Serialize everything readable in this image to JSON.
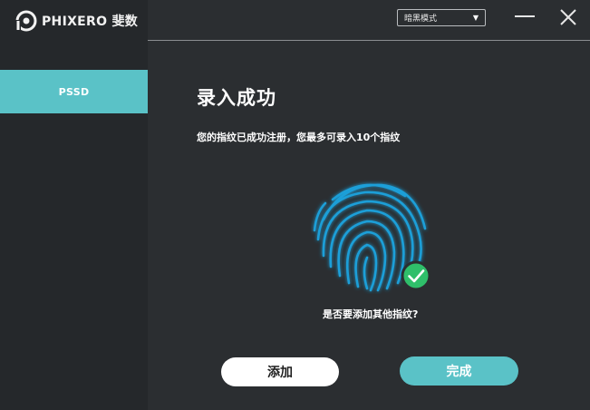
{
  "app": {
    "brand_text": "PHIXERO 斐数"
  },
  "sidebar": {
    "items": [
      {
        "label": "PSSD",
        "active": true
      }
    ]
  },
  "toolbar": {
    "mode_select": {
      "selected": "暗黑模式"
    },
    "icons": [
      "minimize-icon",
      "close-icon"
    ]
  },
  "main": {
    "title": "录入成功",
    "subtitle": "您的指纹已成功注册，您最多可录入10个指纹",
    "question": "是否要添加其他指纹?",
    "add_label": "添加",
    "done_label": "完成",
    "icons": [
      "fingerprint-icon",
      "check-icon"
    ]
  },
  "colors": {
    "accent": "#5ac2c7",
    "fingerprint": "#1e9fd8",
    "success": "#2fbf6a",
    "background": "#2b2e31",
    "sidebar": "#25282b"
  }
}
